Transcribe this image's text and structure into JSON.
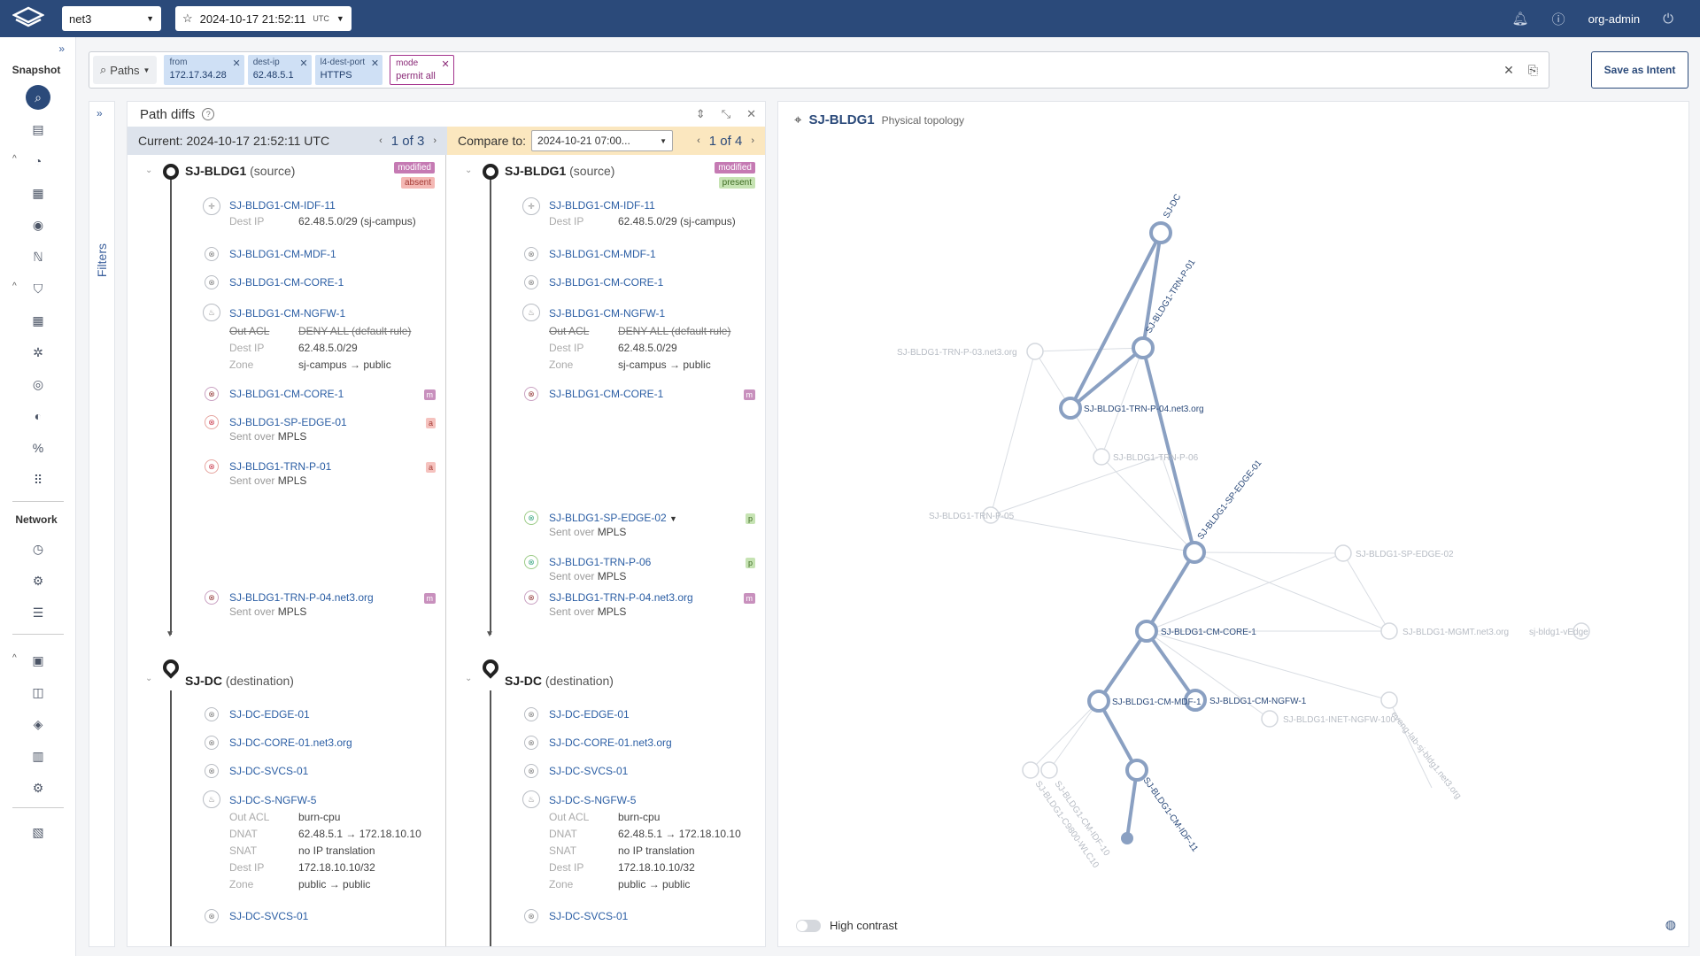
{
  "topbar": {
    "network": "net3",
    "snapshot_time": "2024-10-17  21:52:11",
    "snapshot_tz": "UTC",
    "user": "org-admin"
  },
  "sidebar": {
    "snapshot_label": "Snapshot",
    "network_label": "Network"
  },
  "query": {
    "mode_label": "Paths",
    "chips": [
      {
        "key": "from",
        "value": "172.17.34.28"
      },
      {
        "key": "dest-ip",
        "value": "62.48.5.1"
      },
      {
        "key": "l4-dest-port",
        "value": "HTTPS"
      },
      {
        "key": "mode",
        "value": "permit all"
      }
    ],
    "save_label": "Save as Intent"
  },
  "filters": {
    "label": "Filters"
  },
  "diffs": {
    "title": "Path diffs",
    "current_label": "Current: 2024-10-17  21:52:11 UTC",
    "current_page": "1 of 3",
    "compare_label": "Compare to:",
    "compare_value": "2024-10-21  07:00...",
    "compare_page": "1 of 4",
    "source": {
      "name": "SJ-BLDG1",
      "role": "(source)"
    },
    "destination": {
      "name": "SJ-DC",
      "role": "(destination)"
    },
    "badges": {
      "modified": "modified",
      "absent": "absent",
      "present": "present"
    },
    "kv_keys": {
      "dest_ip": "Dest IP",
      "out_acl": "Out ACL",
      "zone": "Zone",
      "dnat": "DNAT",
      "snat": "SNAT",
      "sent_over": "Sent over",
      "mpls": "MPLS"
    },
    "hops": {
      "idf11": "SJ-BLDG1-CM-IDF-11",
      "idf11_dest": "62.48.5.0/29 (sj-campus)",
      "mdf1": "SJ-BLDG1-CM-MDF-1",
      "core1": "SJ-BLDG1-CM-CORE-1",
      "ngfw1": "SJ-BLDG1-CM-NGFW-1",
      "ngfw1_acl": "DENY ALL (default rule)",
      "ngfw1_dest": "62.48.5.0/29",
      "ngfw1_zone": "sj-campus → public",
      "core1b": "SJ-BLDG1-CM-CORE-1",
      "edge01": "SJ-BLDG1-SP-EDGE-01",
      "trnp01": "SJ-BLDG1-TRN-P-01",
      "edge02": "SJ-BLDG1-SP-EDGE-02",
      "trnp06": "SJ-BLDG1-TRN-P-06",
      "trnp04": "SJ-BLDG1-TRN-P-04.net3.org",
      "dcedge": "SJ-DC-EDGE-01",
      "dccore": "SJ-DC-CORE-01.net3.org",
      "dcsvcs": "SJ-DC-SVCS-01",
      "dcngfw": "SJ-DC-S-NGFW-5",
      "dcngfw_acl": "burn-cpu",
      "dcngfw_dnat": "62.48.5.1 → 172.18.10.10",
      "dcngfw_snat": "no IP translation",
      "dcngfw_dest": "172.18.10.10/32",
      "dcngfw_zone": "public → public",
      "dcsvcs2": "SJ-DC-SVCS-01"
    },
    "marks": {
      "m": "m",
      "a": "a",
      "p": "p"
    }
  },
  "topology": {
    "title": "SJ-BLDG1",
    "subtitle": "Physical topology",
    "high_contrast_label": "High contrast",
    "labels": {
      "sjdc": "SJ-DC",
      "trnp01": "SJ-BLDG1-TRN-P-01",
      "trnp03": "SJ-BLDG1-TRN-P-03.net3.org",
      "trnp04": "SJ-BLDG1-TRN-P-04.net3.org",
      "trnp06": "SJ-BLDG1-TRN-P-06",
      "trnp05": "SJ-BLDG1-TRN-P-05",
      "edge01": "SJ-BLDG1-SP-EDGE-01",
      "edge02": "SJ-BLDG1-SP-EDGE-02",
      "core1": "SJ-BLDG1-CM-CORE-1",
      "mgmt": "SJ-BLDG1-MGMT.net3.org",
      "vedge": "sj-bldg1-vEdge",
      "mdf1": "SJ-BLDG1-CM-MDF-1",
      "ngfw1": "SJ-BLDG1-CM-NGFW-1",
      "inetngfw": "SJ-BLDG1-INET-NGFW-100",
      "idf11": "SJ-BLDG1-CM-IDF-11",
      "idf10": "SJ-BLDG1-CM-IDF-10",
      "c9800": "SJ-BLDG1-C9800-WLC10",
      "eveng": "eveng-lab-sj-bldg1.net3.org"
    }
  }
}
